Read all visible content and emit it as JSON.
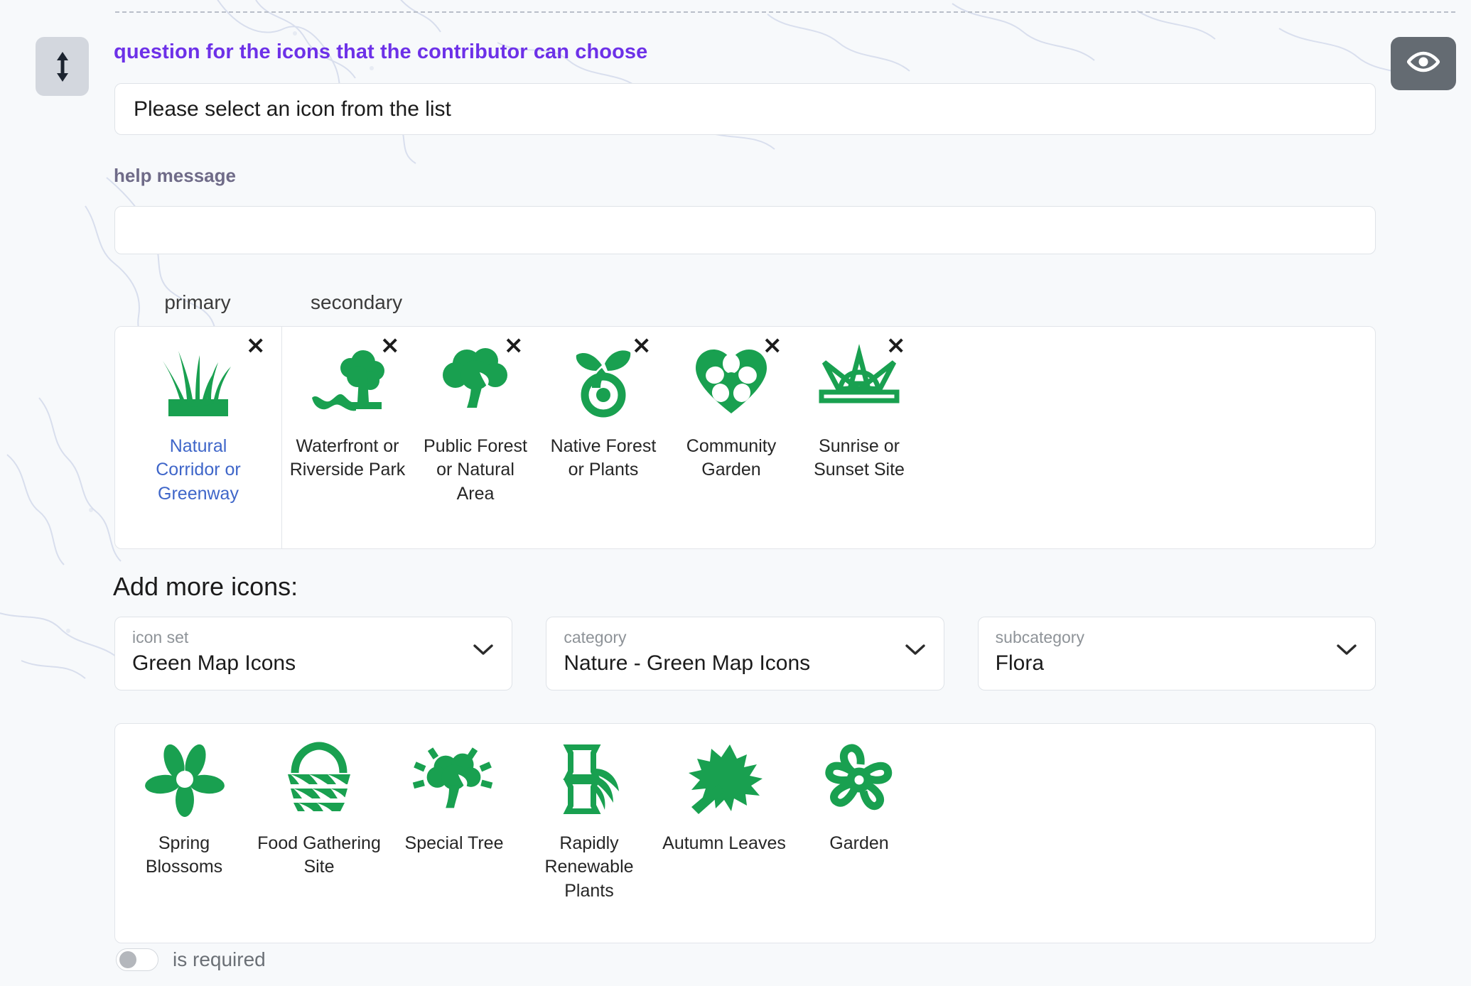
{
  "colors": {
    "accent_purple": "#6d31e8",
    "icon_green": "#19a050",
    "primary_caption_blue": "#3f66c9",
    "background": "#f7f9fb",
    "eye_button_bg": "#646b72",
    "drag_handle_bg": "#d3d7de"
  },
  "header": {
    "drag_handle_icon": "vertical-resize-arrows-icon",
    "preview_icon": "eye-icon",
    "question_label": "question for the icons that the contributor can choose"
  },
  "question_field": {
    "value": "Please select an icon from the list",
    "placeholder": "Please select an icon from the list"
  },
  "help_field": {
    "label": "help message",
    "value": "",
    "placeholder": ""
  },
  "tabs": {
    "primary": "primary",
    "secondary": "secondary"
  },
  "selected_icons": {
    "primary": [
      {
        "label": "Natural Corridor or Greenway",
        "icon": "grass-icon",
        "remove": "×"
      }
    ],
    "secondary": [
      {
        "label": "Waterfront or Riverside Park",
        "icon": "tree-with-water-icon",
        "remove": "×"
      },
      {
        "label": "Public Forest or Natural Area",
        "icon": "tree-icon",
        "remove": "×"
      },
      {
        "label": "Native Forest or Plants",
        "icon": "sprout-icon",
        "remove": "×"
      },
      {
        "label": "Community Garden",
        "icon": "heart-flower-icon",
        "remove": "×"
      },
      {
        "label": "Sunrise or Sunset Site",
        "icon": "sunrise-icon",
        "remove": "×"
      }
    ]
  },
  "add_more": {
    "heading": "Add more icons:",
    "selects": [
      {
        "label": "icon set",
        "value": "Green Map Icons",
        "chevron": "chevron-down-icon"
      },
      {
        "label": "category",
        "value": "Nature - Green Map Icons",
        "chevron": "chevron-down-icon"
      },
      {
        "label": "subcategory",
        "value": "Flora",
        "chevron": "chevron-down-icon"
      }
    ]
  },
  "gallery": [
    {
      "label": "Spring Blossoms",
      "icon": "flower-solid-icon"
    },
    {
      "label": "Food Gathering Site",
      "icon": "basket-icon"
    },
    {
      "label": "Special Tree",
      "icon": "shining-tree-icon"
    },
    {
      "label": "Rapidly Renewable Plants",
      "icon": "bamboo-icon"
    },
    {
      "label": "Autumn Leaves",
      "icon": "maple-leaf-icon"
    },
    {
      "label": "Garden",
      "icon": "flower-outline-icon"
    }
  ],
  "footer": {
    "required_label": "is required",
    "required_on": false
  }
}
